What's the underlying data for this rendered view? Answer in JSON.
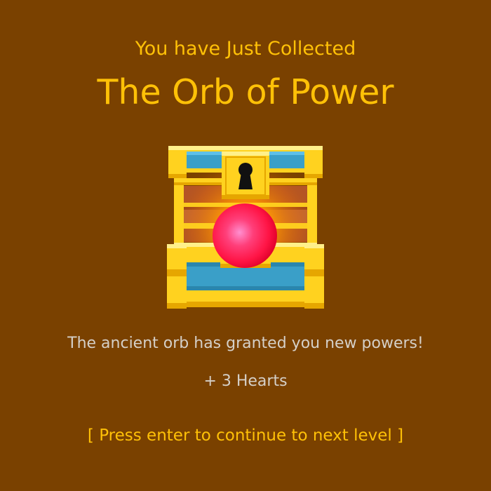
{
  "screen": {
    "subtitle": "You have Just Collected",
    "title": "The Orb of Power",
    "message": "The ancient orb has granted you new powers!",
    "reward": "+ 3 Hearts",
    "prompt": "[ Press enter to continue to next level ]"
  },
  "icons": {
    "chest": "treasure-chest-icon",
    "orb": "glowing-red-orb-icon",
    "keyhole": "keyhole-icon"
  },
  "colors": {
    "background": "#7a4100",
    "heading_text": "#ffc107",
    "body_text": "#d5d0c8",
    "chest_gold": "#ffd21f",
    "chest_blue": "#3a9fc8",
    "orb_red": "#ff1a4a"
  }
}
